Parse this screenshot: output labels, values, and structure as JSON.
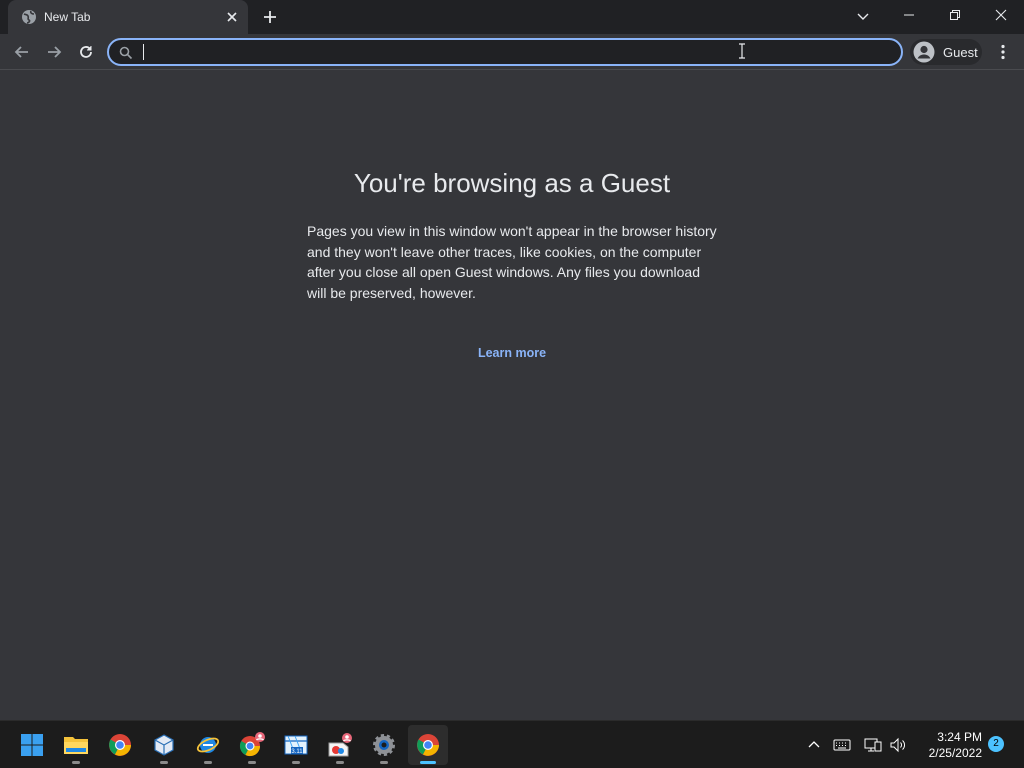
{
  "tab": {
    "title": "New Tab",
    "favicon": "globe-icon"
  },
  "toolbar": {
    "address_value": "",
    "address_placeholder": "",
    "profile_label": "Guest"
  },
  "content": {
    "heading": "You're browsing as a Guest",
    "description": "Pages you view in this window won't appear in the browser history and they won't leave other traces, like cookies, on the computer after you close all open Guest windows. Any files you download will be preserved, however.",
    "learn_more": "Learn more"
  },
  "taskbar": {
    "apps": [
      {
        "name": "start",
        "icon": "windows-start-icon"
      },
      {
        "name": "file-explorer",
        "icon": "folder-icon"
      },
      {
        "name": "chrome",
        "icon": "chrome-icon"
      },
      {
        "name": "virtualbox",
        "icon": "cube-icon"
      },
      {
        "name": "internet-explorer",
        "icon": "ie-icon"
      },
      {
        "name": "chrome-profile",
        "icon": "chrome-icon"
      },
      {
        "name": "app-311",
        "icon": "app-icon",
        "label": "3.11"
      },
      {
        "name": "paint-app",
        "icon": "paint-icon"
      },
      {
        "name": "settings",
        "icon": "gear-icon"
      },
      {
        "name": "chrome-active",
        "icon": "chrome-icon"
      }
    ],
    "clock_time": "3:24 PM",
    "clock_date": "2/25/2022",
    "notification_count": "2"
  },
  "colors": {
    "titlebar": "#202124",
    "content_bg": "#35363a",
    "accent": "#8ab4f8",
    "taskbar_bg": "#1c1c1c",
    "taskbar_active": "#4cc2ff"
  }
}
